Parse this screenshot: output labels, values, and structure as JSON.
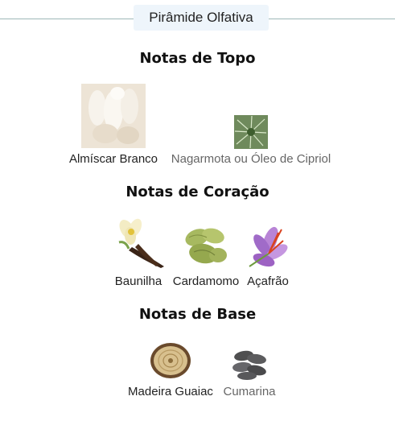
{
  "header": {
    "title": "Pirâmide Olfativa"
  },
  "sections": {
    "top": {
      "title": "Notas de Topo",
      "notes": [
        {
          "label": "Almíscar Branco",
          "icon": "white-musk-image"
        },
        {
          "label": "Nagarmota ou Óleo de Cipriol",
          "icon": "nagarmota-image"
        }
      ]
    },
    "heart": {
      "title": "Notas de Coração",
      "notes": [
        {
          "label": "Baunilha",
          "icon": "vanilla-image"
        },
        {
          "label": "Cardamomo",
          "icon": "cardamom-image"
        },
        {
          "label": "Açafrão",
          "icon": "saffron-image"
        }
      ]
    },
    "base": {
      "title": "Notas de Base",
      "notes": [
        {
          "label": "Madeira Guaiac",
          "icon": "guaiac-wood-image"
        },
        {
          "label": "Cumarina",
          "icon": "coumarin-image"
        }
      ]
    }
  },
  "colors": {
    "header_bg": "#eef5fb",
    "divider": "#9fb8b8",
    "muted_text": "#666666"
  }
}
